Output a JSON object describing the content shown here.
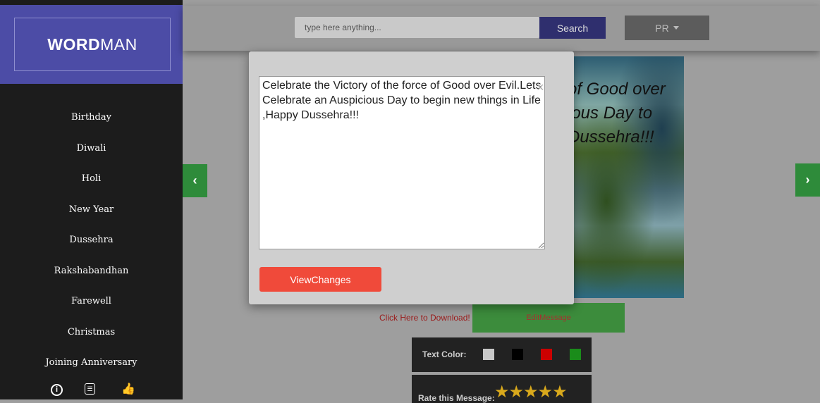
{
  "brand": {
    "bold": "WORD",
    "light": "MAN"
  },
  "sidebar": {
    "items": [
      {
        "label": "Birthday"
      },
      {
        "label": "Diwali"
      },
      {
        "label": "Holi"
      },
      {
        "label": "New Year"
      },
      {
        "label": "Dussehra"
      },
      {
        "label": "Rakshabandhan"
      },
      {
        "label": "Farewell"
      },
      {
        "label": "Christmas"
      },
      {
        "label": "Joining Anniversary"
      }
    ],
    "footer_icons": [
      "info-icon",
      "contact-icon",
      "like-icon"
    ]
  },
  "search": {
    "placeholder": "type here anything...",
    "button_label": "Search"
  },
  "language": {
    "label": "PR"
  },
  "card": {
    "text": "of Good over ious Day to Dussehra!!!"
  },
  "actions": {
    "download_label": "Click Here to Download!",
    "edit_label": "EditMessage"
  },
  "text_color": {
    "label": "Text Color:",
    "swatches": [
      "#c8c8c8",
      "#000000",
      "#cc0000",
      "#1a8c1a"
    ]
  },
  "rating": {
    "label": "Rate this Message:",
    "stars": 5
  },
  "modal": {
    "message": "Celebrate the Victory of the force of Good over Evil.Lets Celebrate an Auspicious Day to begin new things in Life ,Happy Dussehra!!!",
    "close_symbol": "×",
    "view_changes_label": "ViewChanges"
  }
}
